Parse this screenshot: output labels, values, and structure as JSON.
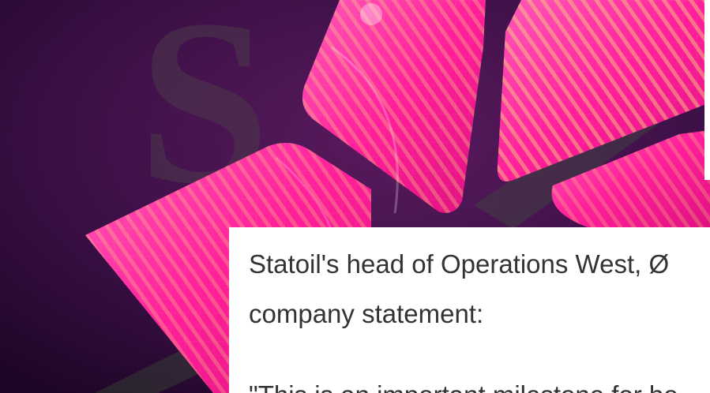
{
  "hero": {
    "colors": {
      "background": "#2e0a3b",
      "magenta": "#ff1f9a",
      "magenta_light": "#ff5ab8",
      "stripe": "#f4d27a",
      "ghost_letter": "#4b3a4a"
    },
    "ghost_letter": "S"
  },
  "article": {
    "paragraph_line_1": "Statoil's head of Operations West, Ø",
    "paragraph_line_2": "company statement:",
    "quote_start": "\"This is an important milestone for bo"
  }
}
